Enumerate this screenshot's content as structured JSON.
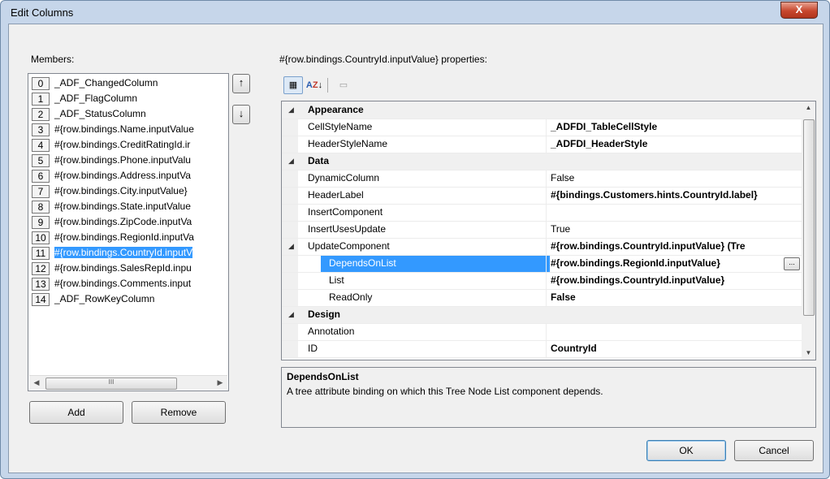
{
  "window": {
    "title": "Edit Columns",
    "close_label": "X"
  },
  "members": {
    "label": "Members:",
    "items": [
      {
        "index": "0",
        "text": "_ADF_ChangedColumn"
      },
      {
        "index": "1",
        "text": "_ADF_FlagColumn"
      },
      {
        "index": "2",
        "text": "_ADF_StatusColumn"
      },
      {
        "index": "3",
        "text": "#{row.bindings.Name.inputValue"
      },
      {
        "index": "4",
        "text": "#{row.bindings.CreditRatingId.ir"
      },
      {
        "index": "5",
        "text": "#{row.bindings.Phone.inputValu"
      },
      {
        "index": "6",
        "text": "#{row.bindings.Address.inputVa"
      },
      {
        "index": "7",
        "text": "#{row.bindings.City.inputValue}"
      },
      {
        "index": "8",
        "text": "#{row.bindings.State.inputValue"
      },
      {
        "index": "9",
        "text": "#{row.bindings.ZipCode.inputVa"
      },
      {
        "index": "10",
        "text": "#{row.bindings.RegionId.inputVa"
      },
      {
        "index": "11",
        "text": "#{row.bindings.CountryId.inputV",
        "selected": true
      },
      {
        "index": "12",
        "text": "#{row.bindings.SalesRepId.inpu"
      },
      {
        "index": "13",
        "text": "#{row.bindings.Comments.input"
      },
      {
        "index": "14",
        "text": "_ADF_RowKeyColumn"
      }
    ],
    "scroll_grip": "III",
    "add_label": "Add",
    "remove_label": "Remove"
  },
  "properties": {
    "header": "#{row.bindings.CountryId.inputValue} properties:",
    "toolbar": {
      "categorized_icon": "categorized-icon",
      "alphabetical_icon": "sort-az-icon",
      "pages_icon": "property-pages-icon"
    },
    "rows": [
      {
        "type": "category",
        "name": "Appearance"
      },
      {
        "type": "prop",
        "name": "CellStyleName",
        "value": "_ADFDI_TableCellStyle",
        "bold": true
      },
      {
        "type": "prop",
        "name": "HeaderStyleName",
        "value": "_ADFDI_HeaderStyle",
        "bold": true
      },
      {
        "type": "category",
        "name": "Data"
      },
      {
        "type": "prop",
        "name": "DynamicColumn",
        "value": "False",
        "bold": false
      },
      {
        "type": "prop",
        "name": "HeaderLabel",
        "value": "#{bindings.Customers.hints.CountryId.label}",
        "bold": true
      },
      {
        "type": "prop",
        "name": "InsertComponent",
        "value": "",
        "bold": false
      },
      {
        "type": "prop",
        "name": "InsertUsesUpdate",
        "value": "True",
        "bold": false
      },
      {
        "type": "prop",
        "name": "UpdateComponent",
        "value": "#{row.bindings.CountryId.inputValue} (Tre",
        "bold": true,
        "expanded": true
      },
      {
        "type": "sub",
        "name": "DependsOnList",
        "value": "#{row.bindings.RegionId.inputValue}",
        "bold": true,
        "selected": true
      },
      {
        "type": "sub",
        "name": "List",
        "value": "#{row.bindings.CountryId.inputValue}",
        "bold": true
      },
      {
        "type": "sub",
        "name": "ReadOnly",
        "value": "False",
        "bold": true
      },
      {
        "type": "category",
        "name": "Design"
      },
      {
        "type": "prop",
        "name": "Annotation",
        "value": "",
        "bold": false
      },
      {
        "type": "prop",
        "name": "ID",
        "value": "CountryId",
        "bold": true
      }
    ],
    "ellipsis_label": "...",
    "description_title": "DependsOnList",
    "description_text": "A tree attribute binding on which this Tree Node List component depends."
  },
  "buttons": {
    "ok": "OK",
    "cancel": "Cancel"
  }
}
